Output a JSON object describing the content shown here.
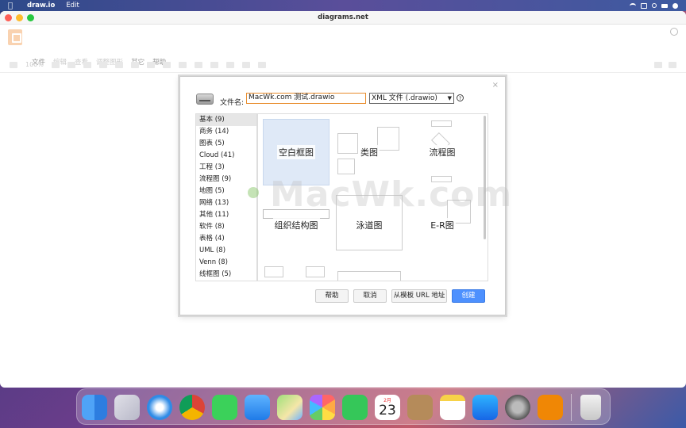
{
  "menubar": {
    "app_name": "draw.io",
    "items": [
      "Edit"
    ]
  },
  "window": {
    "title": "diagrams.net"
  },
  "app_menu": {
    "items": [
      "文件",
      "编辑",
      "查看",
      "调整图形",
      "其它",
      "帮助"
    ]
  },
  "toolbar": {
    "zoom": "100%"
  },
  "dialog": {
    "filename_label": "文件名:",
    "filename_value": "MacWk.com 测试.drawio",
    "format_value": "XML 文件 (.drawio)",
    "help_icon_text": "?",
    "close_icon_text": "×",
    "categories": [
      "基本 (9)",
      "商务 (14)",
      "图表 (5)",
      "Cloud (41)",
      "工程 (3)",
      "流程图 (9)",
      "地图 (5)",
      "网络 (13)",
      "其他 (11)",
      "软件 (8)",
      "表格 (4)",
      "UML (8)",
      "Venn (8)",
      "线框图 (5)"
    ],
    "templates": [
      "空白框图",
      "类图",
      "流程图",
      "组织结构图",
      "泳道图",
      "E-R图"
    ],
    "buttons": {
      "help": "帮助",
      "cancel": "取消",
      "from_url": "从模板 URL 地址",
      "create": "创建"
    }
  },
  "watermark": "MacWk.com",
  "dock": {
    "calendar_month": "2月",
    "calendar_day": "23",
    "apps": [
      "finder-icon",
      "launchpad-icon",
      "safari-icon",
      "chrome-icon",
      "messages-icon",
      "mail-icon",
      "maps-icon",
      "photos-icon",
      "facetime-icon",
      "calendar-icon",
      "contacts-icon",
      "notes-icon",
      "app-store-icon",
      "system-preferences-icon",
      "drawio-icon",
      "trash-icon"
    ]
  }
}
